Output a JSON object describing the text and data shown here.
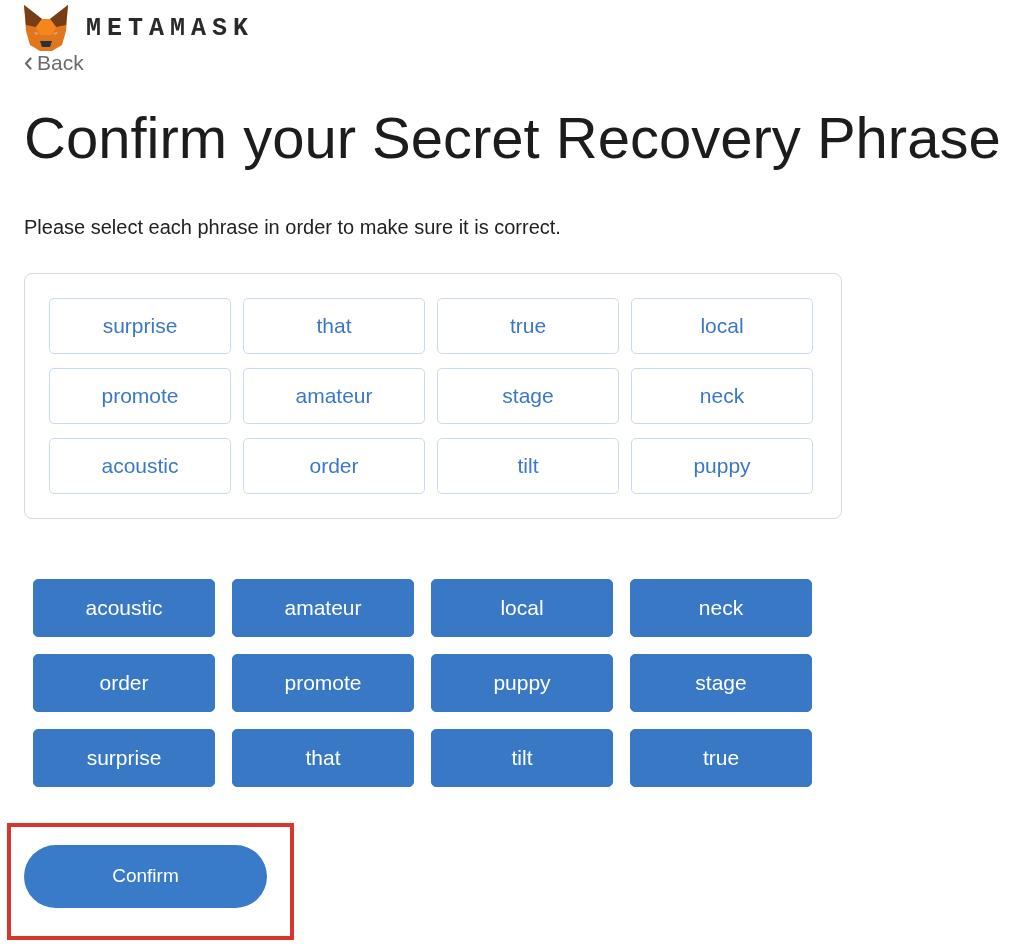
{
  "header": {
    "brand": "METAMASK",
    "back_link": "Back"
  },
  "title": "Confirm your Secret Recovery Phrase",
  "instruction": "Please select each phrase in order to make sure it is correct.",
  "selected_phrase": [
    "surprise",
    "that",
    "true",
    "local",
    "promote",
    "amateur",
    "stage",
    "neck",
    "acoustic",
    "order",
    "tilt",
    "puppy"
  ],
  "word_choices": [
    {
      "word": "acoustic",
      "selected": true
    },
    {
      "word": "amateur",
      "selected": true
    },
    {
      "word": "local",
      "selected": true
    },
    {
      "word": "neck",
      "selected": true
    },
    {
      "word": "order",
      "selected": true
    },
    {
      "word": "promote",
      "selected": true
    },
    {
      "word": "puppy",
      "selected": true
    },
    {
      "word": "stage",
      "selected": true
    },
    {
      "word": "surprise",
      "selected": true
    },
    {
      "word": "that",
      "selected": true
    },
    {
      "word": "tilt",
      "selected": true
    },
    {
      "word": "true",
      "selected": true
    }
  ],
  "confirm_button": {
    "label": "Confirm",
    "highlighted": true
  }
}
